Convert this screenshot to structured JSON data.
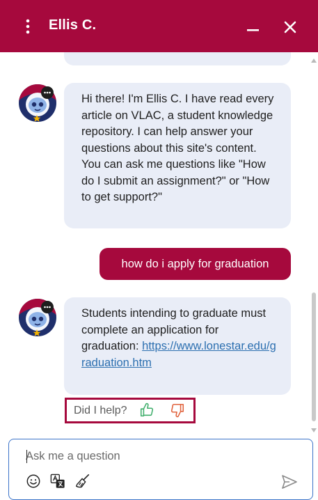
{
  "header": {
    "title": "Ellis C.",
    "colors": {
      "brand": "#a6093d",
      "text": "#ffffff"
    }
  },
  "messages": [
    {
      "from": "bot",
      "text": "Hi there! I'm Ellis C. I have read every article on VLAC, a student knowledge repository. I can help answer your questions about this site's content. You can ask me questions like \"How do I submit an assignment?\" or \"How to get support?\""
    },
    {
      "from": "user",
      "text": "how do i apply for graduation"
    },
    {
      "from": "bot",
      "text": "Students intending to graduate must complete an application for graduation:",
      "link": "https://www.lonestar.edu/graduation.htm"
    }
  ],
  "feedback": {
    "label": "Did I help?",
    "icons": [
      "thumbs-up-icon",
      "thumbs-down-icon"
    ],
    "colors": {
      "up": "#3fae6b",
      "down": "#e0623c",
      "highlight": "#a6093d"
    }
  },
  "composer": {
    "placeholder": "Ask me a question",
    "tools": [
      "emoji-icon",
      "translate-icon",
      "clear-broom-icon"
    ],
    "send_icon": "send-icon"
  },
  "colors": {
    "bot_bubble": "#e9edf7",
    "user_bubble": "#a6093d",
    "link": "#2c6fb0"
  }
}
